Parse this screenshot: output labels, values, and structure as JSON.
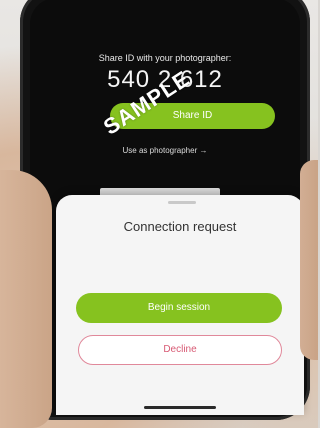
{
  "screen": {
    "share_caption": "Share ID with your photographer:",
    "share_code": "540 2  612",
    "share_button_label": "Share ID",
    "use_as_photographer": "Use as photographer →"
  },
  "watermark": "SAMPLE",
  "dialog": {
    "title": "Connection request",
    "begin_label": "Begin session",
    "decline_label": "Decline"
  },
  "colors": {
    "accent": "#86c21f",
    "decline": "#d85a74",
    "sheet": "#f5f5f5",
    "screen_bg": "#0c0c0c"
  }
}
